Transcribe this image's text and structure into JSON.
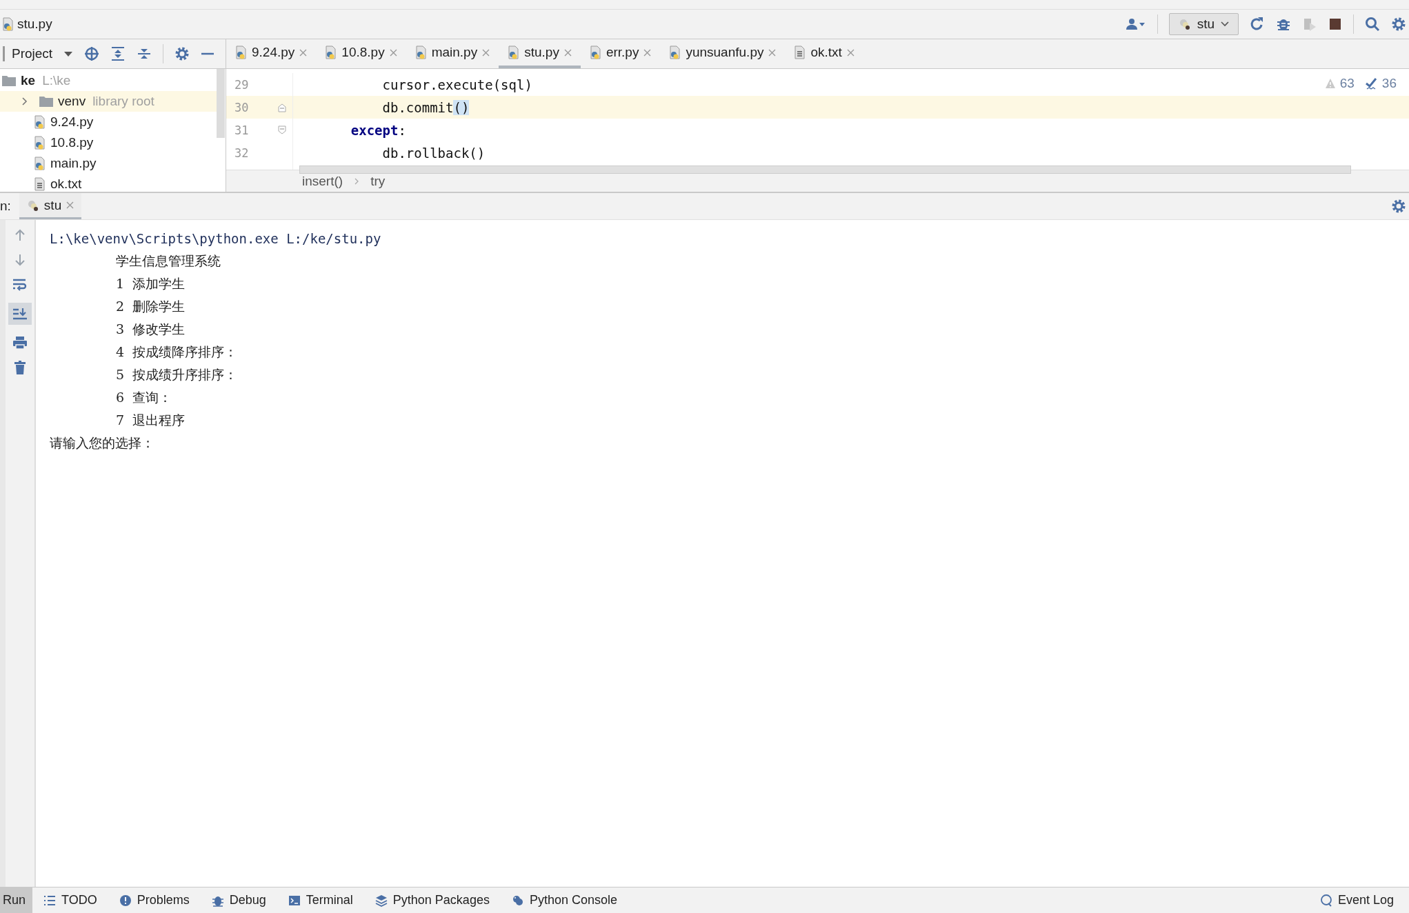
{
  "window": {
    "title": "stu.py"
  },
  "toolbar": {
    "run_config": "stu"
  },
  "project_panel": {
    "title": "Project",
    "tree": [
      {
        "name": "ke",
        "path": "L:\\ke",
        "kind": "root",
        "expanded": true,
        "selected": false,
        "children": [
          {
            "name": "venv",
            "note": "library root",
            "kind": "folder",
            "expanded": false,
            "selected": true
          },
          {
            "name": "9.24.py",
            "kind": "python",
            "selected": false
          },
          {
            "name": "10.8.py",
            "kind": "python",
            "selected": false
          },
          {
            "name": "main.py",
            "kind": "python",
            "selected": false
          },
          {
            "name": "ok.txt",
            "kind": "text",
            "selected": false
          }
        ]
      }
    ]
  },
  "editor_tabs": [
    {
      "label": "9.24.py",
      "kind": "python",
      "selected": false
    },
    {
      "label": "10.8.py",
      "kind": "python",
      "selected": false
    },
    {
      "label": "main.py",
      "kind": "python",
      "selected": false
    },
    {
      "label": "stu.py",
      "kind": "python",
      "selected": true
    },
    {
      "label": "err.py",
      "kind": "python",
      "selected": false
    },
    {
      "label": "yunsuanfu.py",
      "kind": "python",
      "selected": false
    },
    {
      "label": "ok.txt",
      "kind": "text",
      "selected": false
    }
  ],
  "editor": {
    "inspections": {
      "warnings": "63",
      "weak_warnings": "36"
    },
    "lines": [
      {
        "number": "29",
        "current": false,
        "fold_start": false,
        "fold_end": false,
        "segments": [
          {
            "text": "        cursor.execute(sql)",
            "kind": "plain"
          }
        ]
      },
      {
        "number": "30",
        "current": true,
        "fold_start": false,
        "fold_end": true,
        "segments": [
          {
            "text": "        db.commit",
            "kind": "plain"
          },
          {
            "text": "()",
            "kind": "matched"
          }
        ]
      },
      {
        "number": "31",
        "current": false,
        "fold_start": true,
        "fold_end": false,
        "segments": [
          {
            "text": "    except",
            "kind": "keyword"
          },
          {
            "text": ":",
            "kind": "plain"
          }
        ]
      },
      {
        "number": "32",
        "current": false,
        "fold_start": false,
        "fold_end": false,
        "segments": [
          {
            "text": "        db.rollback()",
            "kind": "plain"
          }
        ]
      }
    ],
    "breadcrumbs": [
      "insert()",
      "try"
    ]
  },
  "run_panel": {
    "label": "n:",
    "tabs": [
      {
        "label": "stu",
        "selected": true
      }
    ],
    "scroll_to_end": {
      "on": true
    },
    "output": [
      {
        "kind": "command",
        "text": "L:\\ke\\venv\\Scripts\\python.exe L:/ke/stu.py"
      },
      {
        "kind": "menu",
        "text": "学生信息管理系统"
      },
      {
        "kind": "menu",
        "text": "1  添加学生"
      },
      {
        "kind": "menu",
        "text": "2  删除学生"
      },
      {
        "kind": "menu",
        "text": "3  修改学生"
      },
      {
        "kind": "menu",
        "text": "4  按成绩降序排序："
      },
      {
        "kind": "menu",
        "text": "5  按成绩升序排序："
      },
      {
        "kind": "menu",
        "text": "6  查询："
      },
      {
        "kind": "menu",
        "text": "7  退出程序"
      },
      {
        "kind": "prompt",
        "text": "请输入您的选择："
      }
    ]
  },
  "tool_windows": [
    {
      "label": "Run",
      "kind": "run",
      "selected": true
    },
    {
      "label": "TODO",
      "kind": "todo",
      "selected": false
    },
    {
      "label": "Problems",
      "kind": "problems",
      "selected": false
    },
    {
      "label": "Debug",
      "kind": "debug",
      "selected": false
    },
    {
      "label": "Terminal",
      "kind": "terminal",
      "selected": false
    },
    {
      "label": "Python Packages",
      "kind": "packages",
      "selected": false
    },
    {
      "label": "Python Console",
      "kind": "console",
      "selected": false
    }
  ],
  "event_log": "Event Log"
}
